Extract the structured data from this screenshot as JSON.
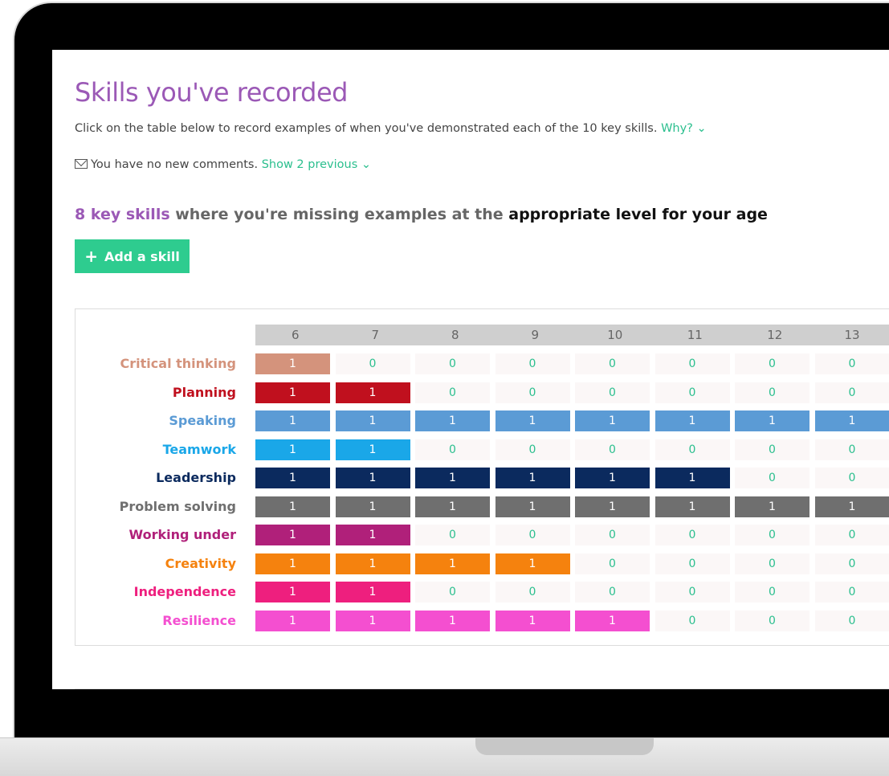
{
  "page": {
    "title": "Skills you've recorded",
    "intro_text": "Click on the table below to record examples of when you've demonstrated each of the 10 key skills. ",
    "why_link": "Why? ⌄",
    "comments_text": "You have no new comments. ",
    "show_previous_link": "Show 2 previous ⌄",
    "missing_count": "8 key skills",
    "missing_middle": " where you're missing examples at the ",
    "missing_emph": "appropriate level for your age",
    "add_button_label": "Add a skill"
  },
  "icons": {
    "mail": "envelope-icon",
    "plus": "plus-icon"
  },
  "table": {
    "ages": [
      "6",
      "7",
      "8",
      "9",
      "10",
      "11",
      "12",
      "13"
    ],
    "rows": [
      {
        "skill": "Critical thinking",
        "color": "#d4937c",
        "values": [
          "1",
          "0",
          "0",
          "0",
          "0",
          "0",
          "0",
          "0"
        ]
      },
      {
        "skill": "Planning",
        "color": "#c0101e",
        "values": [
          "1",
          "1",
          "0",
          "0",
          "0",
          "0",
          "0",
          "0"
        ]
      },
      {
        "skill": "Speaking",
        "color": "#5b9bd5",
        "values": [
          "1",
          "1",
          "1",
          "1",
          "1",
          "1",
          "1",
          "1"
        ]
      },
      {
        "skill": "Teamwork",
        "color": "#1aa7e8",
        "values": [
          "1",
          "1",
          "0",
          "0",
          "0",
          "0",
          "0",
          "0"
        ]
      },
      {
        "skill": "Leadership",
        "color": "#0b2a5e",
        "values": [
          "1",
          "1",
          "1",
          "1",
          "1",
          "1",
          "0",
          "0"
        ]
      },
      {
        "skill": "Problem solving",
        "color": "#6f6f6f",
        "values": [
          "1",
          "1",
          "1",
          "1",
          "1",
          "1",
          "1",
          "1"
        ]
      },
      {
        "skill": "Working under",
        "color": "#b0207a",
        "values": [
          "1",
          "1",
          "0",
          "0",
          "0",
          "0",
          "0",
          "0"
        ]
      },
      {
        "skill": "Creativity",
        "color": "#f5820e",
        "values": [
          "1",
          "1",
          "1",
          "1",
          "0",
          "0",
          "0",
          "0"
        ]
      },
      {
        "skill": "Independence",
        "color": "#ee1f7e",
        "values": [
          "1",
          "1",
          "0",
          "0",
          "0",
          "0",
          "0",
          "0"
        ]
      },
      {
        "skill": "Resilience",
        "color": "#f44fd0",
        "values": [
          "1",
          "1",
          "1",
          "1",
          "1",
          "0",
          "0",
          "0"
        ]
      }
    ]
  }
}
